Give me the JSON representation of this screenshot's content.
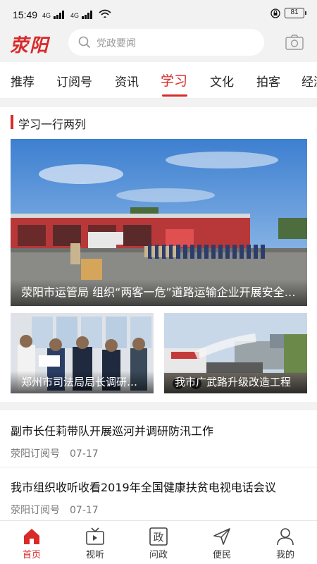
{
  "status": {
    "time": "15:49",
    "signal1": "4G",
    "signal2": "4G",
    "battery": "81"
  },
  "header": {
    "logo": "荥阳",
    "search_placeholder": "党政要闻"
  },
  "tabs": [
    "推荐",
    "订阅号",
    "资讯",
    "学习",
    "文化",
    "拍客",
    "经济"
  ],
  "active_tab": "学习",
  "section": {
    "title": "学习一行两列"
  },
  "featured": {
    "main_caption": "荥阳市运管局 组织“两客一危”道路运输企业开展安全培训",
    "sub_left_caption": "郑州市司法局局长调研指导工作",
    "sub_right_caption": "我市广武路升级改造工程"
  },
  "news": [
    {
      "title": "副市长任莉带队开展巡河并调研防汛工作",
      "source": "荥阳订阅号",
      "date": "07-17"
    },
    {
      "title": "我市组织收听收看2019年全国健康扶贫电视电话会议",
      "source": "荥阳订阅号",
      "date": "07-17"
    }
  ],
  "bottom_nav": [
    {
      "label": "首页",
      "icon": "home-icon",
      "active": true
    },
    {
      "label": "视听",
      "icon": "tv-icon",
      "active": false
    },
    {
      "label": "问政",
      "icon": "politics-icon",
      "active": false
    },
    {
      "label": "便民",
      "icon": "send-icon",
      "active": false
    },
    {
      "label": "我的",
      "icon": "user-icon",
      "active": false
    }
  ],
  "colors": {
    "accent": "#d92a2a",
    "background": "#f2f2f2"
  }
}
